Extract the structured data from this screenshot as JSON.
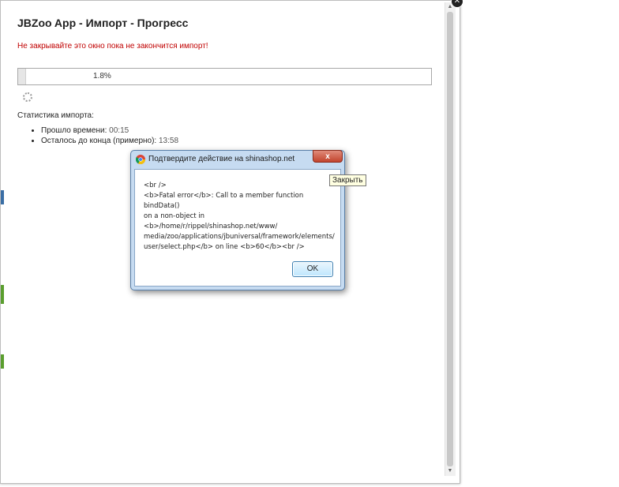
{
  "page": {
    "title": "JBZoo App - Импорт - Прогресс",
    "warning": "Не закрывайте это окно пока не закончится импорт!"
  },
  "progress": {
    "label": "1.8%",
    "value_percent": 1.8
  },
  "stats": {
    "title": "Статистика импорта:",
    "elapsed_label": "Прошло времени:",
    "elapsed_value": "00:15",
    "remaining_label": "Осталось до конца (примерно):",
    "remaining_value": "13:58"
  },
  "dialog": {
    "title": "Подтвердите действие на shinashop.net",
    "close_label": "x",
    "message": "<br />\n<b>Fatal error</b>:  Call to a member function bindData()\non a non-object in <b>/home/r/rippel/shinashop.net/www/\nmedia/zoo/applications/jbuniversal/framework/elements/\nuser/select.php</b> on line <b>60</b><br />",
    "ok_label": "OK"
  },
  "tooltip": {
    "text": "Закрыть"
  },
  "colors": {
    "warning": "#c00000",
    "dialog_frame": "#c6dbf1",
    "close_button": "#c3442d"
  }
}
